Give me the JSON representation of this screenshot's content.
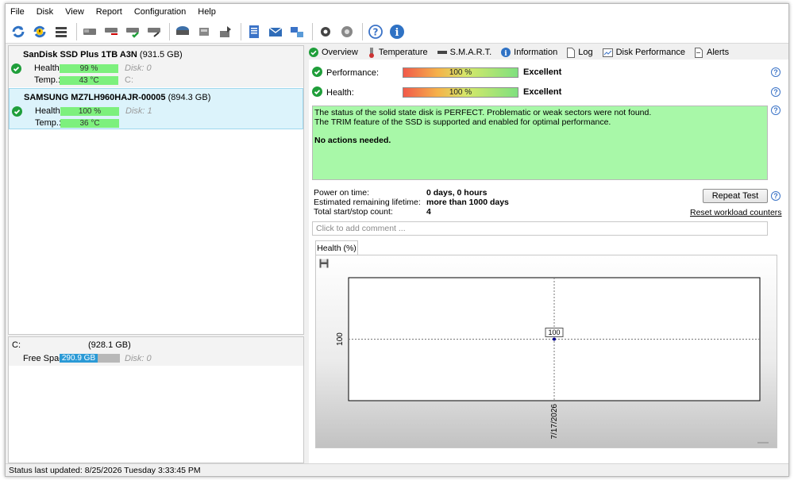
{
  "menu": [
    "File",
    "Disk",
    "View",
    "Report",
    "Configuration",
    "Help"
  ],
  "disks": [
    {
      "name": "SanDisk SSD Plus 1TB A3N",
      "size": "(931.5 GB)",
      "health_label": "Health:",
      "health": "99 %",
      "health_level": 0.99,
      "temp_label": "Temp.:",
      "temp": "43 °C",
      "disk_label": "Disk: 0",
      "drive": "C:"
    },
    {
      "name": "SAMSUNG MZ7LH960HAJR-00005",
      "size": "(894.3 GB)",
      "health_label": "Health:",
      "health": "100 %",
      "health_level": 1.0,
      "temp_label": "Temp.:",
      "temp": "36 °C",
      "disk_label": "Disk: 1",
      "drive": ""
    }
  ],
  "volume": {
    "name": "C:",
    "size": "(928.1 GB)",
    "free_label": "Free Space",
    "free": "290.9 GB",
    "disk_label": "Disk: 0"
  },
  "status_bar": "Status last updated: 8/25/2026 Tuesday 3:33:45 PM",
  "tabs": [
    "Overview",
    "Temperature",
    "S.M.A.R.T.",
    "Information",
    "Log",
    "Disk Performance",
    "Alerts"
  ],
  "overview": {
    "performance_label": "Performance:",
    "performance_value": "100 %",
    "performance_rating": "Excellent",
    "health_label": "Health:",
    "health_value": "100 %",
    "health_rating": "Excellent",
    "message_line1": "The status of the solid state disk is PERFECT. Problematic or weak sectors were not found.",
    "message_line2": "The TRIM feature of the SSD is supported and enabled for optimal performance.",
    "message_line3": "No actions needed.",
    "power_on_label": "Power on time:",
    "power_on_value": "0 days, 0 hours",
    "lifetime_label": "Estimated remaining lifetime:",
    "lifetime_value": "more than 1000 days",
    "startstop_label": "Total start/stop count:",
    "startstop_value": "4",
    "repeat_button": "Repeat Test",
    "reset_link": "Reset workload counters",
    "comment_placeholder": "Click to add comment ..."
  },
  "chart_tab": "Health (%)",
  "chart_data": {
    "type": "line",
    "x": [
      "7/17/2026"
    ],
    "series": [
      {
        "values": [
          100
        ]
      }
    ],
    "data_labels": [
      "100"
    ],
    "ytick": "100",
    "xtick": "7/17/2026",
    "grid": true
  },
  "colors": {
    "ok_green": "#1f9e3a",
    "bar_green": "#7df07d",
    "free_blue": "#2b9ad6",
    "message_bg": "#a8f8a8",
    "accent_blue": "#3b73c7"
  }
}
